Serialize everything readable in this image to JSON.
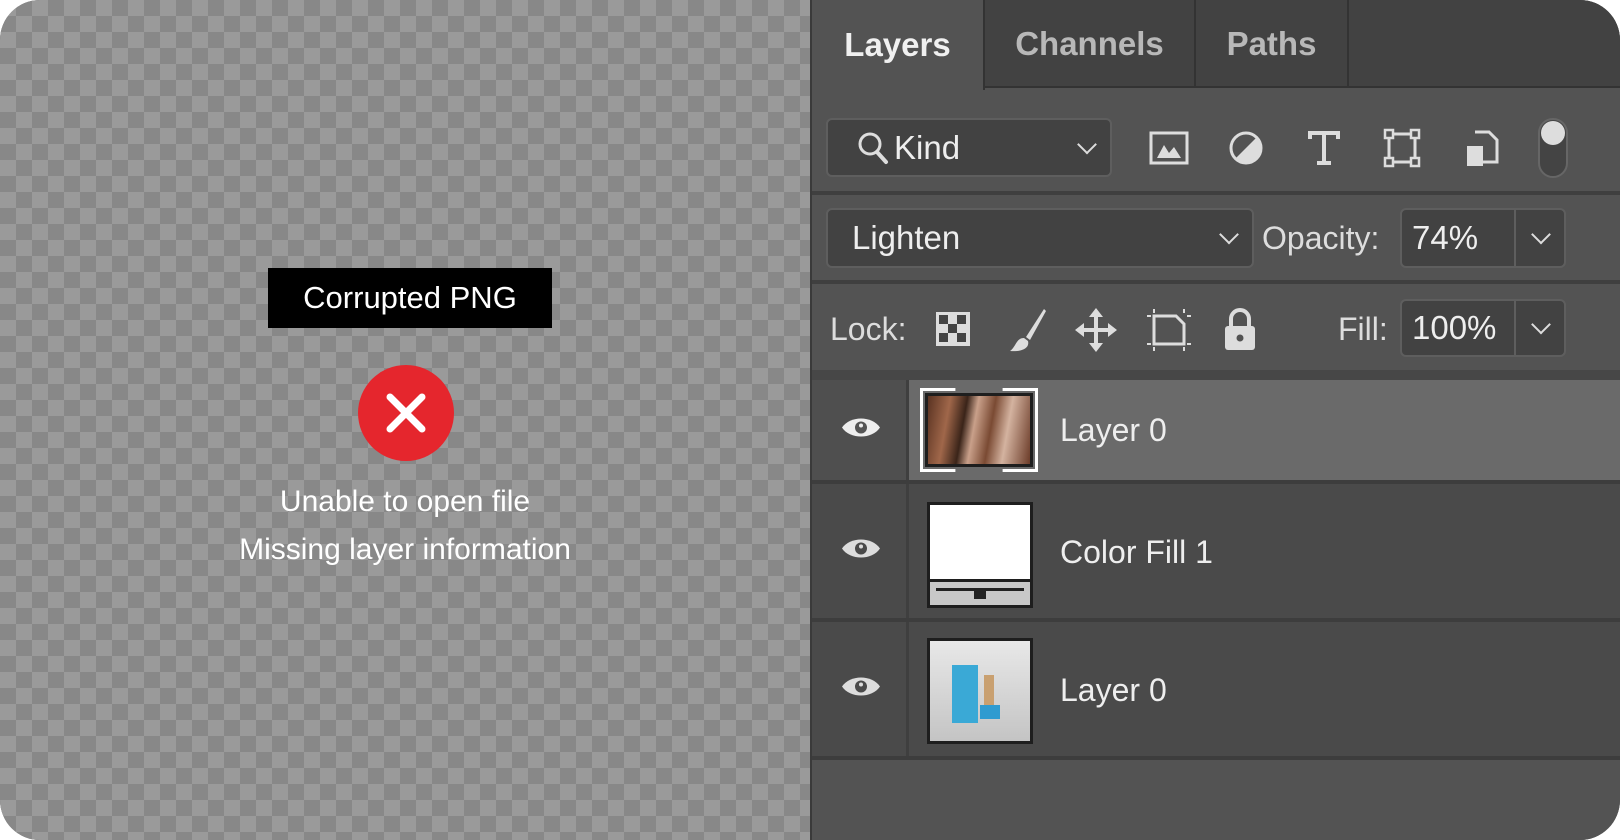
{
  "canvas": {
    "error_title": "Corrupted PNG",
    "error_icon": "x-circle-icon",
    "error_line1": "Unable to open file",
    "error_line2": "Missing layer information",
    "error_color": "#e5262d"
  },
  "panel": {
    "tabs": [
      {
        "label": "Layers",
        "active": true
      },
      {
        "label": "Channels",
        "active": false
      },
      {
        "label": "Paths",
        "active": false
      }
    ],
    "filter": {
      "label": "Kind",
      "icons": [
        "image-filter-icon",
        "adjustment-filter-icon",
        "type-filter-icon",
        "shape-filter-icon",
        "smart-object-filter-icon",
        "filter-toggle"
      ]
    },
    "blend_mode": "Lighten",
    "opacity_label": "Opacity:",
    "opacity": "74%",
    "lock_label": "Lock:",
    "fill_label": "Fill:",
    "fill": "100%",
    "layers": [
      {
        "name": "Layer 0",
        "selected": true,
        "visible": true
      },
      {
        "name": "Color Fill 1",
        "selected": false,
        "visible": true
      },
      {
        "name": "Layer 0",
        "selected": false,
        "visible": true
      }
    ]
  }
}
